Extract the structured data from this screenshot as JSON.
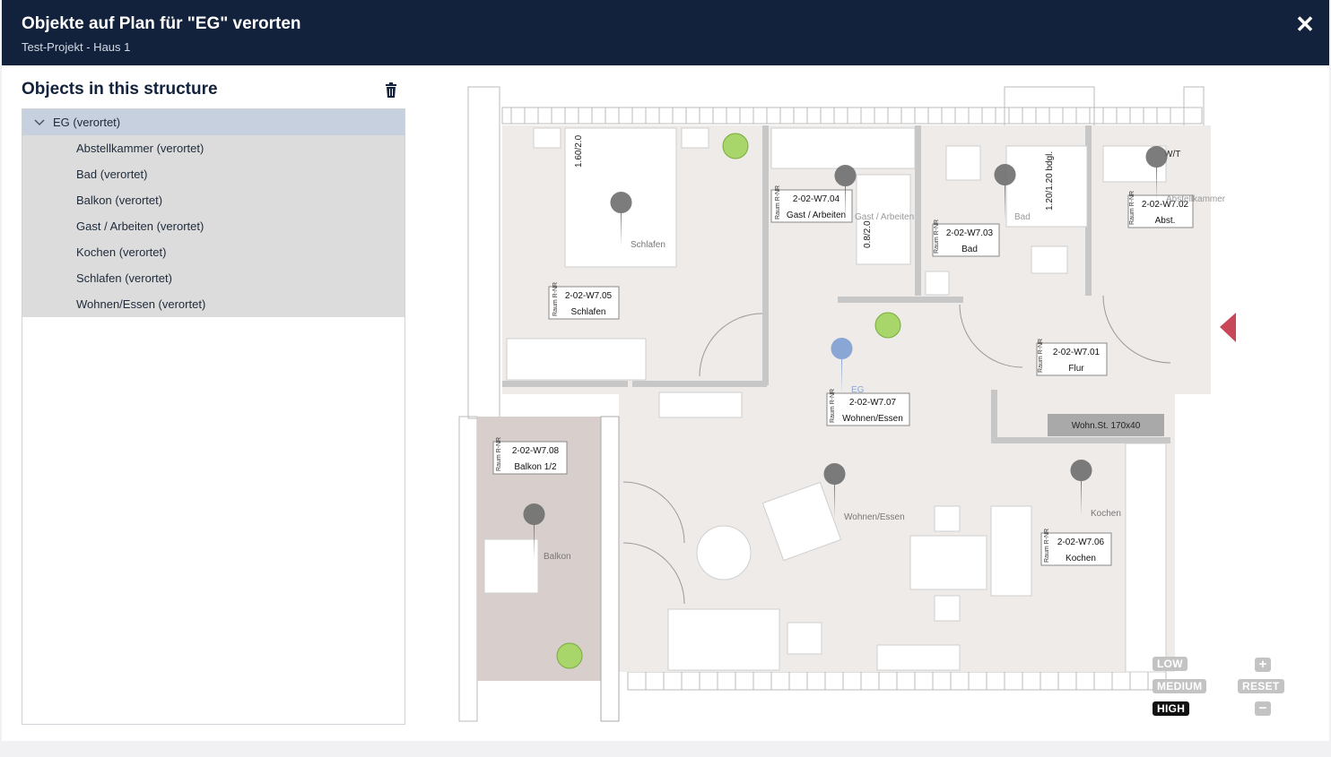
{
  "header": {
    "title": "Objekte auf Plan für \"EG\" verorten",
    "subtitle": "Test-Projekt - Haus 1",
    "close_label": "✕"
  },
  "panel": {
    "title": "Objects in this structure",
    "tree_root": "EG (verortet)",
    "items": [
      "Abstellkammer (verortet)",
      "Bad (verortet)",
      "Balkon (verortet)",
      "Gast / Arbeiten (verortet)",
      "Kochen (verortet)",
      "Schlafen (verortet)",
      "Wohnen/Essen (verortet)"
    ]
  },
  "plan": {
    "rooms": [
      {
        "nr": "2-02-W7.05",
        "name": "Schlafen"
      },
      {
        "nr": "2-02-W7.04",
        "name": "Gast / Arbeiten"
      },
      {
        "nr": "2-02-W7.03",
        "name": "Bad"
      },
      {
        "nr": "2-02-W7.02",
        "name": "Abst."
      },
      {
        "nr": "2-02-W7.01",
        "name": "Flur"
      },
      {
        "nr": "2-02-W7.07",
        "name": "Wohnen/Essen"
      },
      {
        "nr": "2-02-W7.08",
        "name": "Balkon 1/2"
      },
      {
        "nr": "2-02-W7.06",
        "name": "Kochen"
      }
    ],
    "raum_tag": "Raum R-NR",
    "pin_labels": [
      "Schlafen",
      "Gast / Arbeiten",
      "Bad",
      "Abstellkammer",
      "EG",
      "Wohnen/Essen",
      "Balkon",
      "Kochen"
    ],
    "dims": [
      "1.60/2.0",
      "0.8/2.0",
      "1.20/1.20 bdgl.",
      "W/T"
    ],
    "wohn_st": "Wohn.St. 170x40"
  },
  "zoom": {
    "low": "LOW",
    "medium": "MEDIUM",
    "high": "HIGH",
    "reset": "RESET",
    "plus": "+",
    "minus": "−",
    "active": "HIGH"
  },
  "colors": {
    "header_bg": "#13223c",
    "pin_gray": "#6e6e6e",
    "pin_blue": "#8aa6d4",
    "arrow_red": "#c8485a"
  }
}
